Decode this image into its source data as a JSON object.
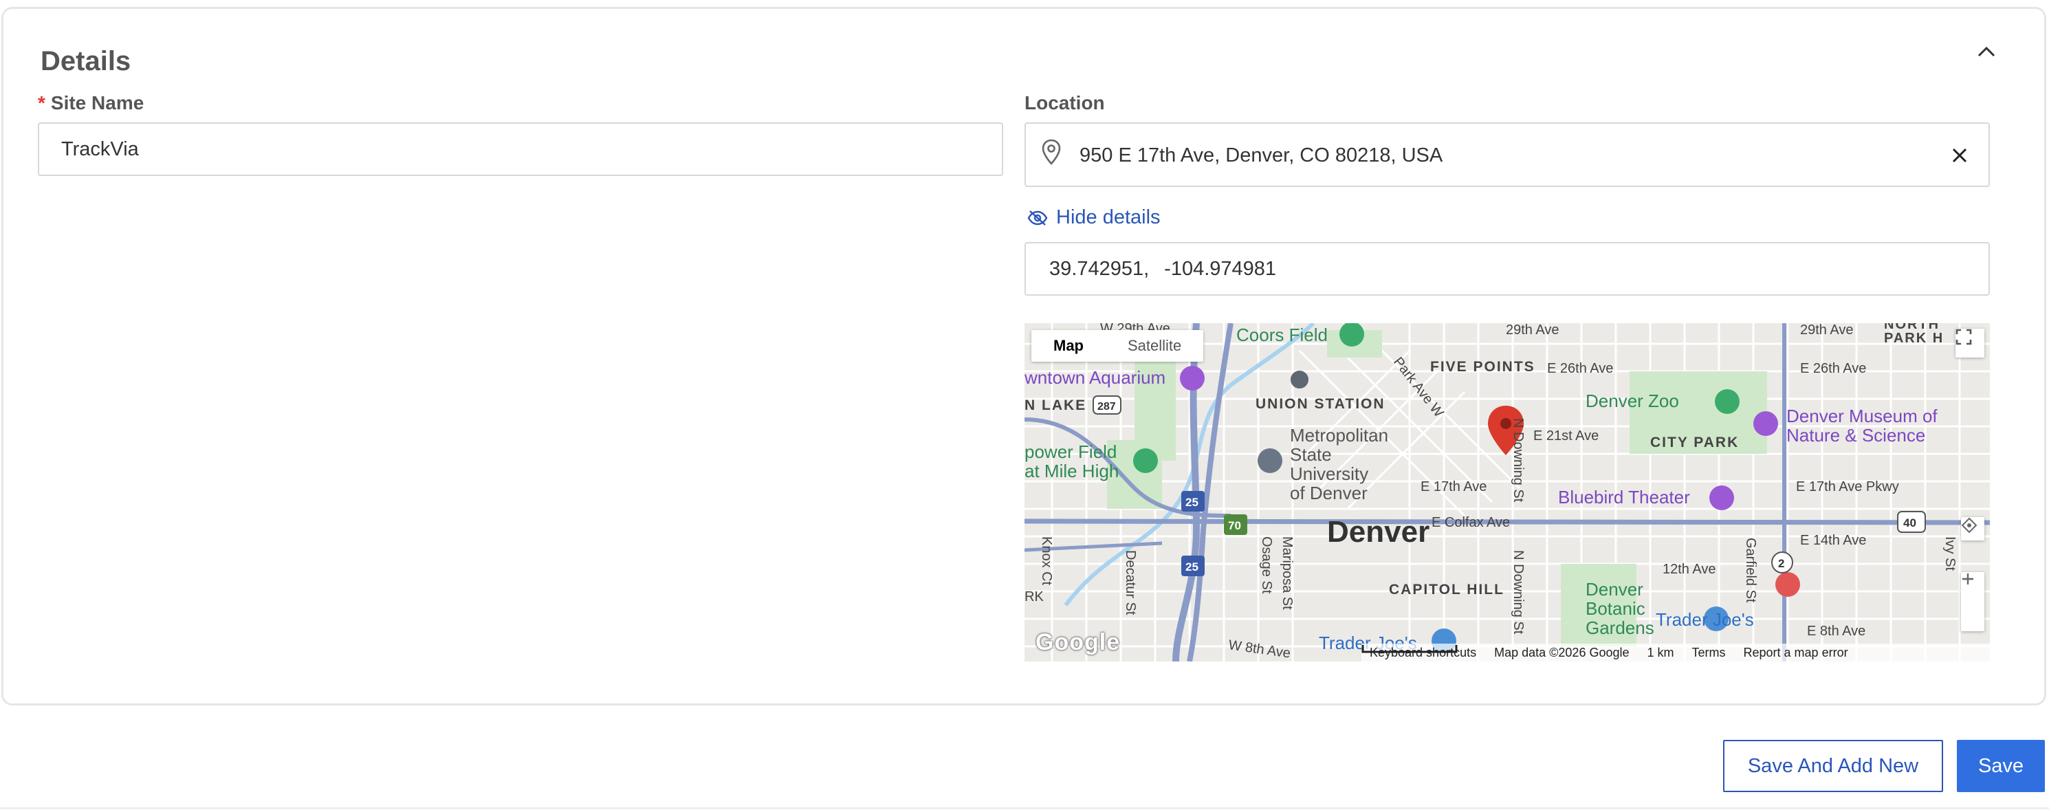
{
  "section": {
    "title": "Details"
  },
  "site_name": {
    "required_mark": "*",
    "label": "Site Name",
    "value": "TrackVia"
  },
  "location": {
    "label": "Location",
    "value": "950 E 17th Ave, Denver, CO 80218, USA",
    "hide_details_label": "Hide details",
    "latitude": "39.742951,",
    "longitude": "-104.974981"
  },
  "map": {
    "type_options": [
      "Map",
      "Satellite"
    ],
    "selected_type": "Map",
    "logo": "Google",
    "footer": {
      "shortcuts": "Keyboard shortcuts",
      "data": "Map data ©2026 Google",
      "scale": "1 km",
      "terms": "Terms",
      "report": "Report a map error"
    },
    "labels": {
      "city": "Denver",
      "union_station": "UNION STATION",
      "five_points": "FIVE POINTS",
      "city_park": "CITY PARK",
      "capitol_hill": "CAPITOL HILL",
      "lower_lake": "N LAKE",
      "coors_field": "Coors Field",
      "aquarium": "wntown Aquarium",
      "empower_field_1": "power Field",
      "empower_field_2": "at Mile High",
      "metro_1": "Metropolitan",
      "metro_2": "State",
      "metro_3": "University",
      "metro_4": "of Denver",
      "denver_zoo": "Denver Zoo",
      "museum_1": "Denver Museum of",
      "museum_2": "Nature & Science",
      "bluebird": "Bluebird Theater",
      "botanic_1": "Denver",
      "botanic_2": "Botanic",
      "botanic_3": "Gardens",
      "trader_joes": "Trader Joe's",
      "trader_joes_2": "Trader Joe's",
      "north_park_1": "NORTH",
      "north_park_2": "PARK H",
      "e_29th_1": "29th Ave",
      "e_29th_2": "29th Ave",
      "w_29th": "W 29th Ave",
      "e_26th_1": "E 26th Ave",
      "e_26th_2": "E 26th Ave",
      "e_21st": "E 21st Ave",
      "e_17th": "E 17th Ave",
      "e_17th_pkwy": "E 17th Ave Pkwy",
      "e_colfax": "E Colfax Ave",
      "e_14th": "E 14th Ave",
      "e_12th": "12th Ave",
      "e_8th": "E 8th Ave",
      "w_8th": "W 8th Ave",
      "park_ave": "Park Ave W",
      "n_downing_1": "N Downing St",
      "n_downing_2": "N Downing St",
      "knox": "Knox Ct",
      "decatur": "Decatur St",
      "osage": "Osage St",
      "mariposa": "Mariposa St",
      "garfield": "Garfield St",
      "ivy": "Ivy St",
      "rk": "RK",
      "shield_287": "287",
      "shield_25a": "25",
      "shield_25b": "25",
      "shield_70": "70",
      "shield_40": "40",
      "shield_2": "2"
    }
  },
  "actions": {
    "save_and_add_new": "Save And Add New",
    "save": "Save"
  },
  "colors": {
    "primary": "#2f6fe0",
    "link": "#2a56b8",
    "required": "#e53935",
    "pin": "#d93a2b"
  }
}
